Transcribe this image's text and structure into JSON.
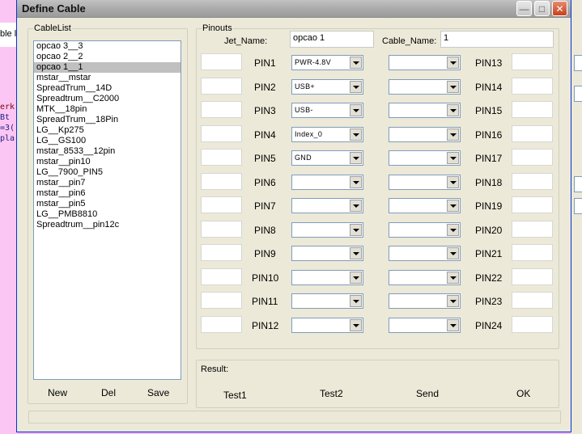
{
  "background_app": {
    "label": "ble l",
    "code_lines": [
      "erk",
      " Bt",
      "=3(",
      "pla"
    ]
  },
  "window": {
    "title": "Define Cable"
  },
  "cable_list": {
    "group_label": "CableList",
    "selected_index": 2,
    "items": [
      "opcao 3__3",
      "opcao 2__2",
      "opcao 1__1",
      "mstar__mstar",
      "SpreadTrum__14D",
      "Spreadtrum__C2000",
      "MTK__18pin",
      "SpreadTrum__18Pin",
      "LG__Kp275",
      "LG__GS100",
      "mstar_8533__12pin",
      "mstar__pin10",
      "LG__7900_PIN5",
      "mstar__pin7",
      "mstar__pin6",
      "mstar__pin5",
      "LG__PMB8810",
      "Spreadtrum__pin12c"
    ],
    "buttons": {
      "new": "New",
      "del": "Del",
      "save": "Save"
    }
  },
  "pinouts": {
    "group_label": "Pinouts",
    "jet_name_label": "Jet_Name:",
    "jet_name_value": "opcao 1",
    "cable_name_label": "Cable_Name:",
    "cable_name_value": "1",
    "left_pins": [
      {
        "label": "PIN1",
        "value": "PWR-4.8V"
      },
      {
        "label": "PIN2",
        "value": "USB+"
      },
      {
        "label": "PIN3",
        "value": "USB-"
      },
      {
        "label": "PIN4",
        "value": "Index_0"
      },
      {
        "label": "PIN5",
        "value": "GND"
      },
      {
        "label": "PIN6",
        "value": ""
      },
      {
        "label": "PIN7",
        "value": ""
      },
      {
        "label": "PIN8",
        "value": ""
      },
      {
        "label": "PIN9",
        "value": ""
      },
      {
        "label": "PIN10",
        "value": ""
      },
      {
        "label": "PIN11",
        "value": ""
      },
      {
        "label": "PIN12",
        "value": ""
      }
    ],
    "right_pins": [
      {
        "label": "PIN13",
        "value": ""
      },
      {
        "label": "PIN14",
        "value": ""
      },
      {
        "label": "PIN15",
        "value": ""
      },
      {
        "label": "PIN16",
        "value": ""
      },
      {
        "label": "PIN17",
        "value": ""
      },
      {
        "label": "PIN18",
        "value": ""
      },
      {
        "label": "PIN19",
        "value": ""
      },
      {
        "label": "PIN20",
        "value": ""
      },
      {
        "label": "PIN21",
        "value": ""
      },
      {
        "label": "PIN22",
        "value": ""
      },
      {
        "label": "PIN23",
        "value": ""
      },
      {
        "label": "PIN24",
        "value": ""
      }
    ]
  },
  "result": {
    "label": "Result:",
    "buttons": {
      "test1": "Test1",
      "test2": "Test2",
      "send": "Send",
      "ok": "OK"
    }
  }
}
